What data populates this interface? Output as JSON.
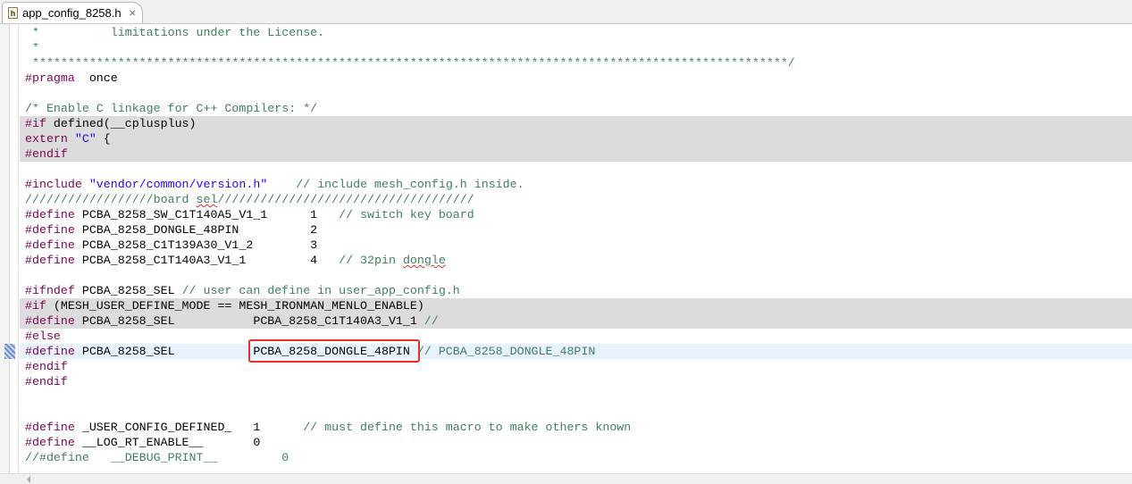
{
  "tab": {
    "filename": "app_config_8258.h",
    "icon": "c-header-file-icon",
    "close_icon": "close-icon"
  },
  "colors": {
    "preprocessor": "#7f0055",
    "string": "#2a00ff",
    "comment": "#3f7f5f",
    "inactive_bg": "#dcdcdc",
    "current_line_bg": "#e8f2fe",
    "highlight_box": "#e8302a"
  },
  "lines": [
    {
      "t": [
        [
          "cm",
          " *          limitations under the License."
        ]
      ]
    },
    {
      "t": [
        [
          "cm",
          " *"
        ]
      ]
    },
    {
      "t": [
        [
          "cm",
          " **********************************************************************************************************/"
        ]
      ]
    },
    {
      "t": [
        [
          "kw",
          "#pragma"
        ],
        [
          "",
          "  once"
        ]
      ]
    },
    {
      "t": []
    },
    {
      "t": [
        [
          "cm",
          "/* Enable C linkage for C++ Compilers: */"
        ]
      ]
    },
    {
      "s": "inactive",
      "t": [
        [
          "kw",
          "#if"
        ],
        [
          "",
          " defined(__cplusplus)"
        ]
      ]
    },
    {
      "s": "inactive",
      "t": [
        [
          "kw",
          "extern"
        ],
        [
          "",
          " "
        ],
        [
          "str",
          "\"C\""
        ],
        [
          "",
          " {"
        ]
      ]
    },
    {
      "s": "inactive",
      "t": [
        [
          "kw",
          "#endif"
        ]
      ]
    },
    {
      "t": []
    },
    {
      "t": [
        [
          "kw",
          "#include"
        ],
        [
          "",
          " "
        ],
        [
          "str",
          "\"vendor/common/version.h\""
        ],
        [
          "",
          "    "
        ],
        [
          "cm",
          "// include mesh_config.h inside."
        ]
      ]
    },
    {
      "t": [
        [
          "cm",
          "//////////////////board "
        ],
        [
          "cmsp",
          "sel"
        ],
        [
          "cm",
          "////////////////////////////////////"
        ]
      ]
    },
    {
      "t": [
        [
          "kw",
          "#define"
        ],
        [
          "",
          " PCBA_8258_SW_C1T140A5_V1_1      1   "
        ],
        [
          "cm",
          "// switch key board"
        ]
      ]
    },
    {
      "t": [
        [
          "kw",
          "#define"
        ],
        [
          "",
          " PCBA_8258_DONGLE_48PIN          2"
        ]
      ]
    },
    {
      "t": [
        [
          "kw",
          "#define"
        ],
        [
          "",
          " PCBA_8258_C1T139A30_V1_2        3"
        ]
      ]
    },
    {
      "t": [
        [
          "kw",
          "#define"
        ],
        [
          "",
          " PCBA_8258_C1T140A3_V1_1         4   "
        ],
        [
          "cm",
          "// 32pin "
        ],
        [
          "cmsp",
          "dongle"
        ]
      ]
    },
    {
      "t": []
    },
    {
      "t": [
        [
          "kw",
          "#ifndef"
        ],
        [
          "",
          " PCBA_8258_SEL "
        ],
        [
          "cm",
          "// user can define in user_app_config.h"
        ]
      ]
    },
    {
      "s": "inactive",
      "t": [
        [
          "kw",
          "#if"
        ],
        [
          "",
          " (MESH_USER_DEFINE_MODE == MESH_IRONMAN_MENLO_ENABLE)"
        ]
      ]
    },
    {
      "s": "inactive",
      "t": [
        [
          "kw",
          "#define"
        ],
        [
          "",
          " PCBA_8258_SEL           PCBA_8258_C1T140A3_V1_1 "
        ],
        [
          "cm",
          "//"
        ]
      ]
    },
    {
      "t": [
        [
          "kw",
          "#else"
        ]
      ]
    },
    {
      "s": "current",
      "t": [
        [
          "kw",
          "#define"
        ],
        [
          "",
          " PCBA_8258_SEL           PCBA_8258_DONGLE_48PIN "
        ],
        [
          "cm",
          "// PCBA_8258_DONGLE_48PIN"
        ]
      ]
    },
    {
      "t": [
        [
          "kw",
          "#endif"
        ]
      ]
    },
    {
      "t": [
        [
          "kw",
          "#endif"
        ]
      ]
    },
    {
      "t": []
    },
    {
      "t": []
    },
    {
      "t": [
        [
          "kw",
          "#define"
        ],
        [
          "",
          " _USER_CONFIG_DEFINED_   1      "
        ],
        [
          "cm",
          "// must define this macro to make others known"
        ]
      ]
    },
    {
      "t": [
        [
          "kw",
          "#define"
        ],
        [
          "",
          " __LOG_RT_ENABLE__       0"
        ]
      ]
    },
    {
      "t": [
        [
          "cm",
          "//#define   __DEBUG_PRINT__         0"
        ]
      ]
    }
  ]
}
